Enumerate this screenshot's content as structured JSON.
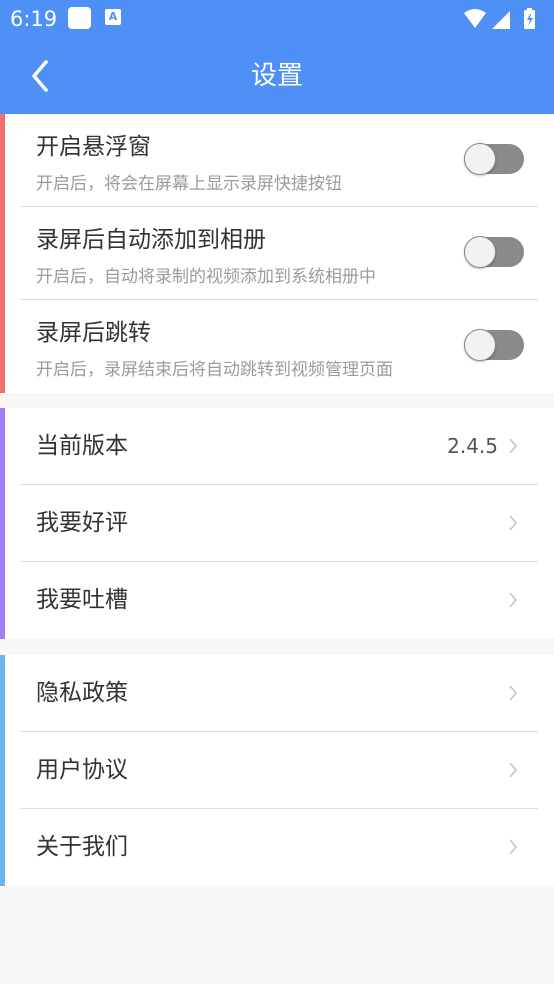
{
  "status_bar": {
    "time": "6:19",
    "icons": [
      "app-icon",
      "translate-icon",
      "wifi-icon",
      "signal-icon",
      "battery-icon"
    ]
  },
  "header": {
    "title": "设置",
    "back_icon": "chevron-left-icon"
  },
  "colors": {
    "primary": "#4f90f6",
    "accent_section1": "#f26d6d",
    "accent_section2": "#a07cf5",
    "accent_section3": "#6bb6ee",
    "switch_off": "#8a8a8a"
  },
  "toggles": [
    {
      "title": "开启悬浮窗",
      "subtitle": "开启后，将会在屏幕上显示录屏快捷按钮",
      "on": false
    },
    {
      "title": "录屏后自动添加到相册",
      "subtitle": "开启后，自动将录制的视频添加到系统相册中",
      "on": false
    },
    {
      "title": "录屏后跳转",
      "subtitle": "开启后，录屏结束后将自动跳转到视频管理页面",
      "on": false
    }
  ],
  "about": [
    {
      "title": "当前版本",
      "value": "2.4.5"
    },
    {
      "title": "我要好评"
    },
    {
      "title": "我要吐槽"
    }
  ],
  "legal": [
    {
      "title": "隐私政策"
    },
    {
      "title": "用户协议"
    },
    {
      "title": "关于我们"
    }
  ]
}
